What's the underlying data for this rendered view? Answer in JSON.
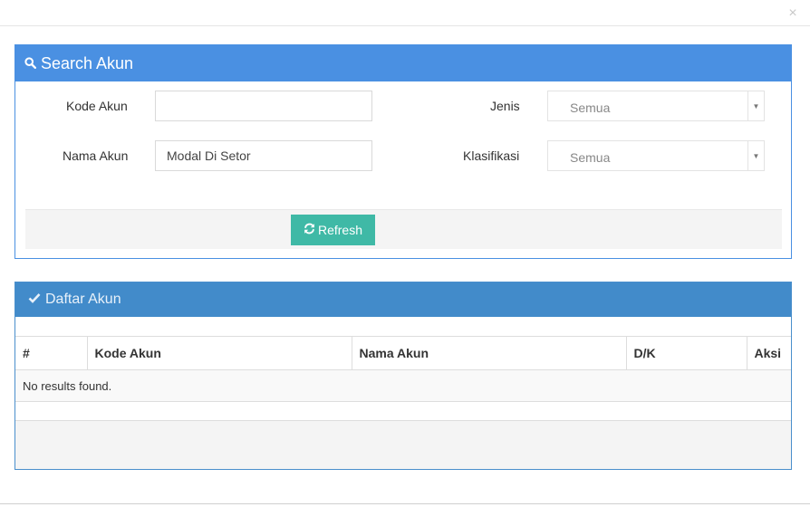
{
  "modal": {
    "close_glyph": "×"
  },
  "search_panel": {
    "title": "Search Akun",
    "fields": {
      "kode_akun": {
        "label": "Kode Akun",
        "value": "",
        "placeholder": ""
      },
      "nama_akun": {
        "label": "Nama Akun",
        "value": "Modal Di Setor"
      },
      "jenis": {
        "label": "Jenis",
        "selected": "Semua"
      },
      "klasifikasi": {
        "label": "Klasifikasi",
        "selected": "Semua"
      }
    },
    "refresh_label": "Refresh"
  },
  "list_panel": {
    "title": "Daftar Akun",
    "columns": [
      "#",
      "Kode Akun",
      "Nama Akun",
      "D/K",
      "Aksi"
    ],
    "empty_message": "No results found."
  },
  "icons": {
    "search": "search-icon",
    "refresh": "refresh-icon",
    "check": "check-icon",
    "close": "close-icon",
    "dropdown": "caret-down-icon"
  },
  "colors": {
    "search_header": "#4a90e2",
    "list_header": "#428bca",
    "refresh_button": "#3fb9a6"
  }
}
